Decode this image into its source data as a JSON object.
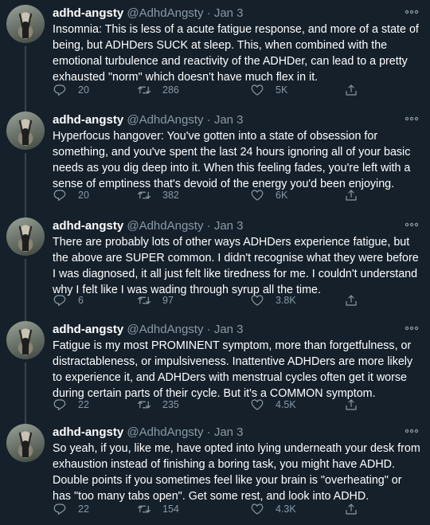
{
  "tweets": [
    {
      "name": "adhd-angsty",
      "handle": "@AdhdAngsty",
      "separator": "·",
      "date": "Jan 3",
      "text": "Insomnia: This is less of a acute fatigue response, and more of a state of being, but ADHDers SUCK at sleep. This, when combined with the emotional turbulence and reactivity of the ADHDer, can lead to a pretty exhausted \"norm\" which doesn't have much flex in it.",
      "replies": "20",
      "retweets": "286",
      "likes": "5K"
    },
    {
      "name": "adhd-angsty",
      "handle": "@AdhdAngsty",
      "separator": "·",
      "date": "Jan 3",
      "text": "Hyperfocus hangover: You've gotten into a state of obsession for something, and you've spent the last 24 hours ignoring all of your basic needs as you dig deep into it. When this feeling fades, you're left with a sense of emptiness that's devoid of the energy you'd been enjoying.",
      "replies": "20",
      "retweets": "382",
      "likes": "6K"
    },
    {
      "name": "adhd-angsty",
      "handle": "@AdhdAngsty",
      "separator": "·",
      "date": "Jan 3",
      "text": "There are probably lots of other ways ADHDers experience fatigue, but the above are SUPER common. I didn't recognise what they were before I was diagnosed, it all just felt like tiredness for me. I couldn't understand why I felt like I was wading through syrup all the time.",
      "replies": "6",
      "retweets": "97",
      "likes": "3.8K"
    },
    {
      "name": "adhd-angsty",
      "handle": "@AdhdAngsty",
      "separator": "·",
      "date": "Jan 3",
      "text": "Fatigue is my most PROMINENT symptom, more than forgetfulness, or distractableness, or impulsiveness. Inattentive ADHDers are more likely to experience it, and ADHDers with menstrual cycles often get it worse during certain parts of their cycle. But it's a COMMON symptom.",
      "replies": "22",
      "retweets": "235",
      "likes": "4.5K"
    },
    {
      "name": "adhd-angsty",
      "handle": "@AdhdAngsty",
      "separator": "·",
      "date": "Jan 3",
      "text": "So yeah, if you, like me, have opted into lying underneath your desk from exhaustion instead of finishing a boring task, you might have ADHD. Double points if you sometimes feel like your brain is \"overheating\" or has \"too many tabs open\". Get some rest, and look into ADHD.",
      "replies": "22",
      "retweets": "154",
      "likes": "4.3K"
    }
  ]
}
